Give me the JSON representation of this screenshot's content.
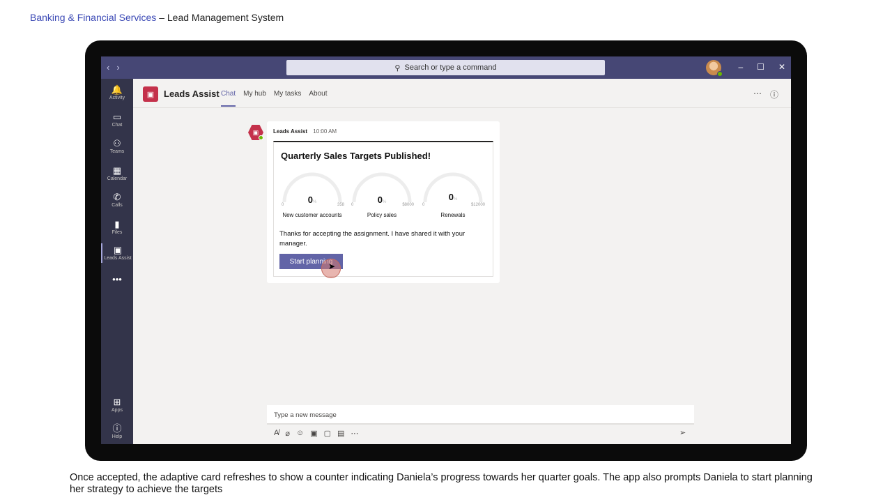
{
  "page_header": {
    "accent": "Banking & Financial Services",
    "rest": " – Lead Management System"
  },
  "titlebar": {
    "back_icon": "chevron-left-icon",
    "forward_icon": "chevron-right-icon",
    "search_placeholder": "Search or type a command",
    "window_buttons": {
      "minimize": "–",
      "maximize": "☐",
      "close": "✕"
    }
  },
  "rail": {
    "items": [
      {
        "label": "Activity",
        "icon": "bell-icon",
        "glyph": "🔔"
      },
      {
        "label": "Chat",
        "icon": "chat-icon",
        "glyph": "▭"
      },
      {
        "label": "Teams",
        "icon": "teams-icon",
        "glyph": "⚇"
      },
      {
        "label": "Calendar",
        "icon": "calendar-icon",
        "glyph": "▦"
      },
      {
        "label": "Calls",
        "icon": "phone-icon",
        "glyph": "✆"
      },
      {
        "label": "Files",
        "icon": "file-icon",
        "glyph": "▮"
      },
      {
        "label": "Leads Assist",
        "icon": "bot-icon",
        "glyph": "▣"
      }
    ],
    "more_glyph": "•••",
    "apps_label": "Apps",
    "help_label": "Help"
  },
  "app": {
    "title": "Leads Assist",
    "tabs": [
      "Chat",
      "My hub",
      "My tasks",
      "About"
    ],
    "active_tab": "Chat"
  },
  "message": {
    "sender": "Leads Assist",
    "time": "10:00 AM",
    "card": {
      "title": "Quarterly Sales Targets Published!",
      "gauges": [
        {
          "value": "0",
          "unit": "%",
          "min": "0",
          "max": "358",
          "label": "New customer accounts",
          "progress": 0
        },
        {
          "value": "0",
          "unit": "%",
          "min": "0",
          "max": "$8000",
          "label": "Policy sales",
          "progress": 0
        },
        {
          "value": "0",
          "unit": "%",
          "min": "0",
          "max": "$12000",
          "label": "Renewals",
          "progress": 0
        }
      ],
      "text": "Thanks for accepting the assignment. I have shared it with your manager.",
      "button_label": "Start planning"
    }
  },
  "compose": {
    "placeholder": "Type a new message"
  },
  "caption": "Once accepted, the adaptive card refreshes to show a counter indicating Daniela’s progress towards her quarter goals. The app also prompts Daniela to start planning her strategy to achieve the targets",
  "colors": {
    "brand_purple": "#6264a7",
    "titlebar": "#464775",
    "rail": "#33344a",
    "bot_red": "#c4314b"
  }
}
